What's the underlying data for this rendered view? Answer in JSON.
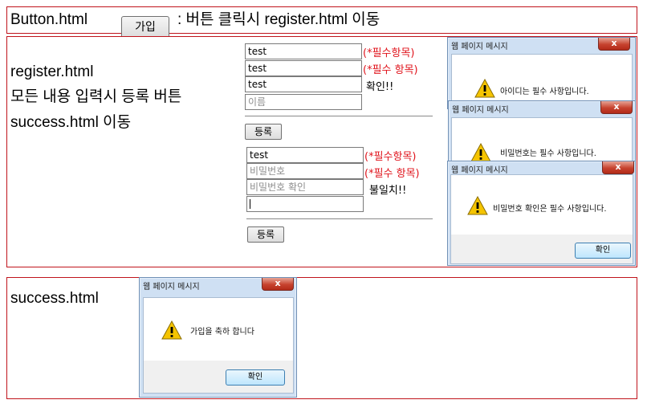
{
  "section_button": {
    "filename": "Button.html",
    "join_label": "가입",
    "description": ":  버튼 클릭시 register.html 이동"
  },
  "section_register": {
    "line1": "register.html",
    "line2": "모든 내용 입력시 등록 버튼",
    "line3": "success.html 이동",
    "form1": {
      "field1": "test",
      "field2": "test",
      "field3": "test",
      "field4_placeholder": "이름",
      "req1": "(*필수항목)",
      "req2": "(*필수 항목)",
      "confirm_note": "확인!!",
      "submit_label": "등록"
    },
    "form2": {
      "field1": "test",
      "field2_placeholder": "비밀번호",
      "field3_placeholder": "비밀번호 확인",
      "req1": "(*필수항목)",
      "req2": "(*필수 항목)",
      "mismatch_note": "불일치!!",
      "submit_label": "등록"
    },
    "dialogs": [
      {
        "title": "웹 페이지 메시지",
        "close": "x",
        "message": "아이디는 필수 사항입니다."
      },
      {
        "title": "웹 페이지 메시지",
        "close": "x",
        "message": "비밀번호는 필수 사항입니다."
      },
      {
        "title": "웹 페이지 메시지",
        "close": "x",
        "message": "비밀번호 확인은 필수 사항입니다.",
        "ok": "확인"
      }
    ]
  },
  "section_success": {
    "filename": "success.html",
    "dialog": {
      "title": "웹 페이지 메시지",
      "close": "x",
      "message": "가입을 축하 합니다",
      "ok": "확인"
    }
  },
  "colors": {
    "border": "#c0141c",
    "required": "#e0141c",
    "warning_icon": "#f5c400"
  }
}
